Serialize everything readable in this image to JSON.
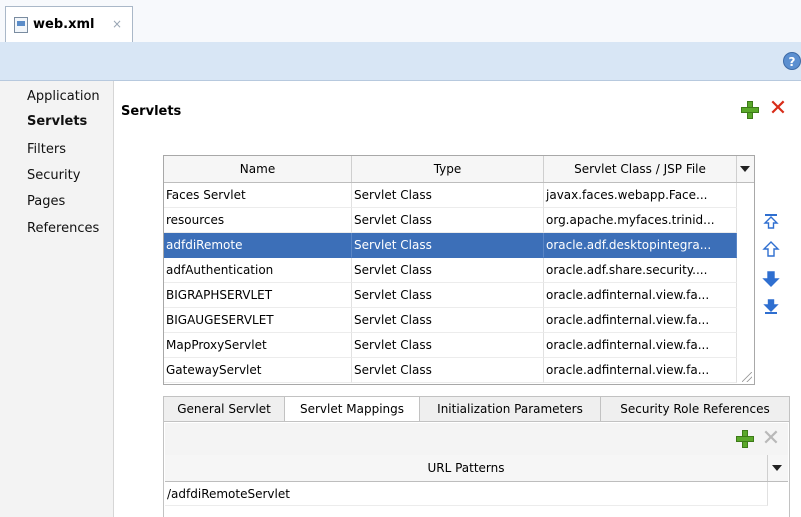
{
  "editor_tab": {
    "label": "web.xml",
    "close": "×"
  },
  "help": "?",
  "nav": {
    "items": [
      "Application",
      "Servlets",
      "Filters",
      "Security",
      "Pages",
      "References"
    ],
    "active": "Servlets"
  },
  "section": {
    "title": "Servlets"
  },
  "table": {
    "columns": [
      "Name",
      "Type",
      "Servlet Class / JSP File"
    ],
    "rows": [
      [
        "Faces Servlet",
        "Servlet Class",
        "javax.faces.webapp.Face..."
      ],
      [
        "resources",
        "Servlet Class",
        "org.apache.myfaces.trinid..."
      ],
      [
        "adfdiRemote",
        "Servlet Class",
        "oracle.adf.desktopintegra..."
      ],
      [
        "adfAuthentication",
        "Servlet Class",
        "oracle.adf.share.security...."
      ],
      [
        "BIGRAPHSERVLET",
        "Servlet Class",
        "oracle.adfinternal.view.fa..."
      ],
      [
        "BIGAUGESERVLET",
        "Servlet Class",
        "oracle.adfinternal.view.fa..."
      ],
      [
        "MapProxyServlet",
        "Servlet Class",
        "oracle.adfinternal.view.fa..."
      ],
      [
        "GatewayServlet",
        "Servlet Class",
        "oracle.adfinternal.view.fa..."
      ]
    ],
    "selected_row": "adfdiRemote"
  },
  "order_buttons": [
    "move-top-icon",
    "move-up-icon",
    "move-down-icon",
    "move-bottom-icon"
  ],
  "subtabs": {
    "items": [
      "General Servlet",
      "Servlet Mappings",
      "Initialization Parameters",
      "Security Role References"
    ],
    "active": "Servlet Mappings"
  },
  "mappings": {
    "column": "URL Patterns",
    "values": [
      "/adfdiRemoteServlet"
    ]
  },
  "colors": {
    "selection": "#3c6fb8",
    "add": "#5aa82a",
    "delete": "#d82c18",
    "band": "#d8e6f5"
  }
}
